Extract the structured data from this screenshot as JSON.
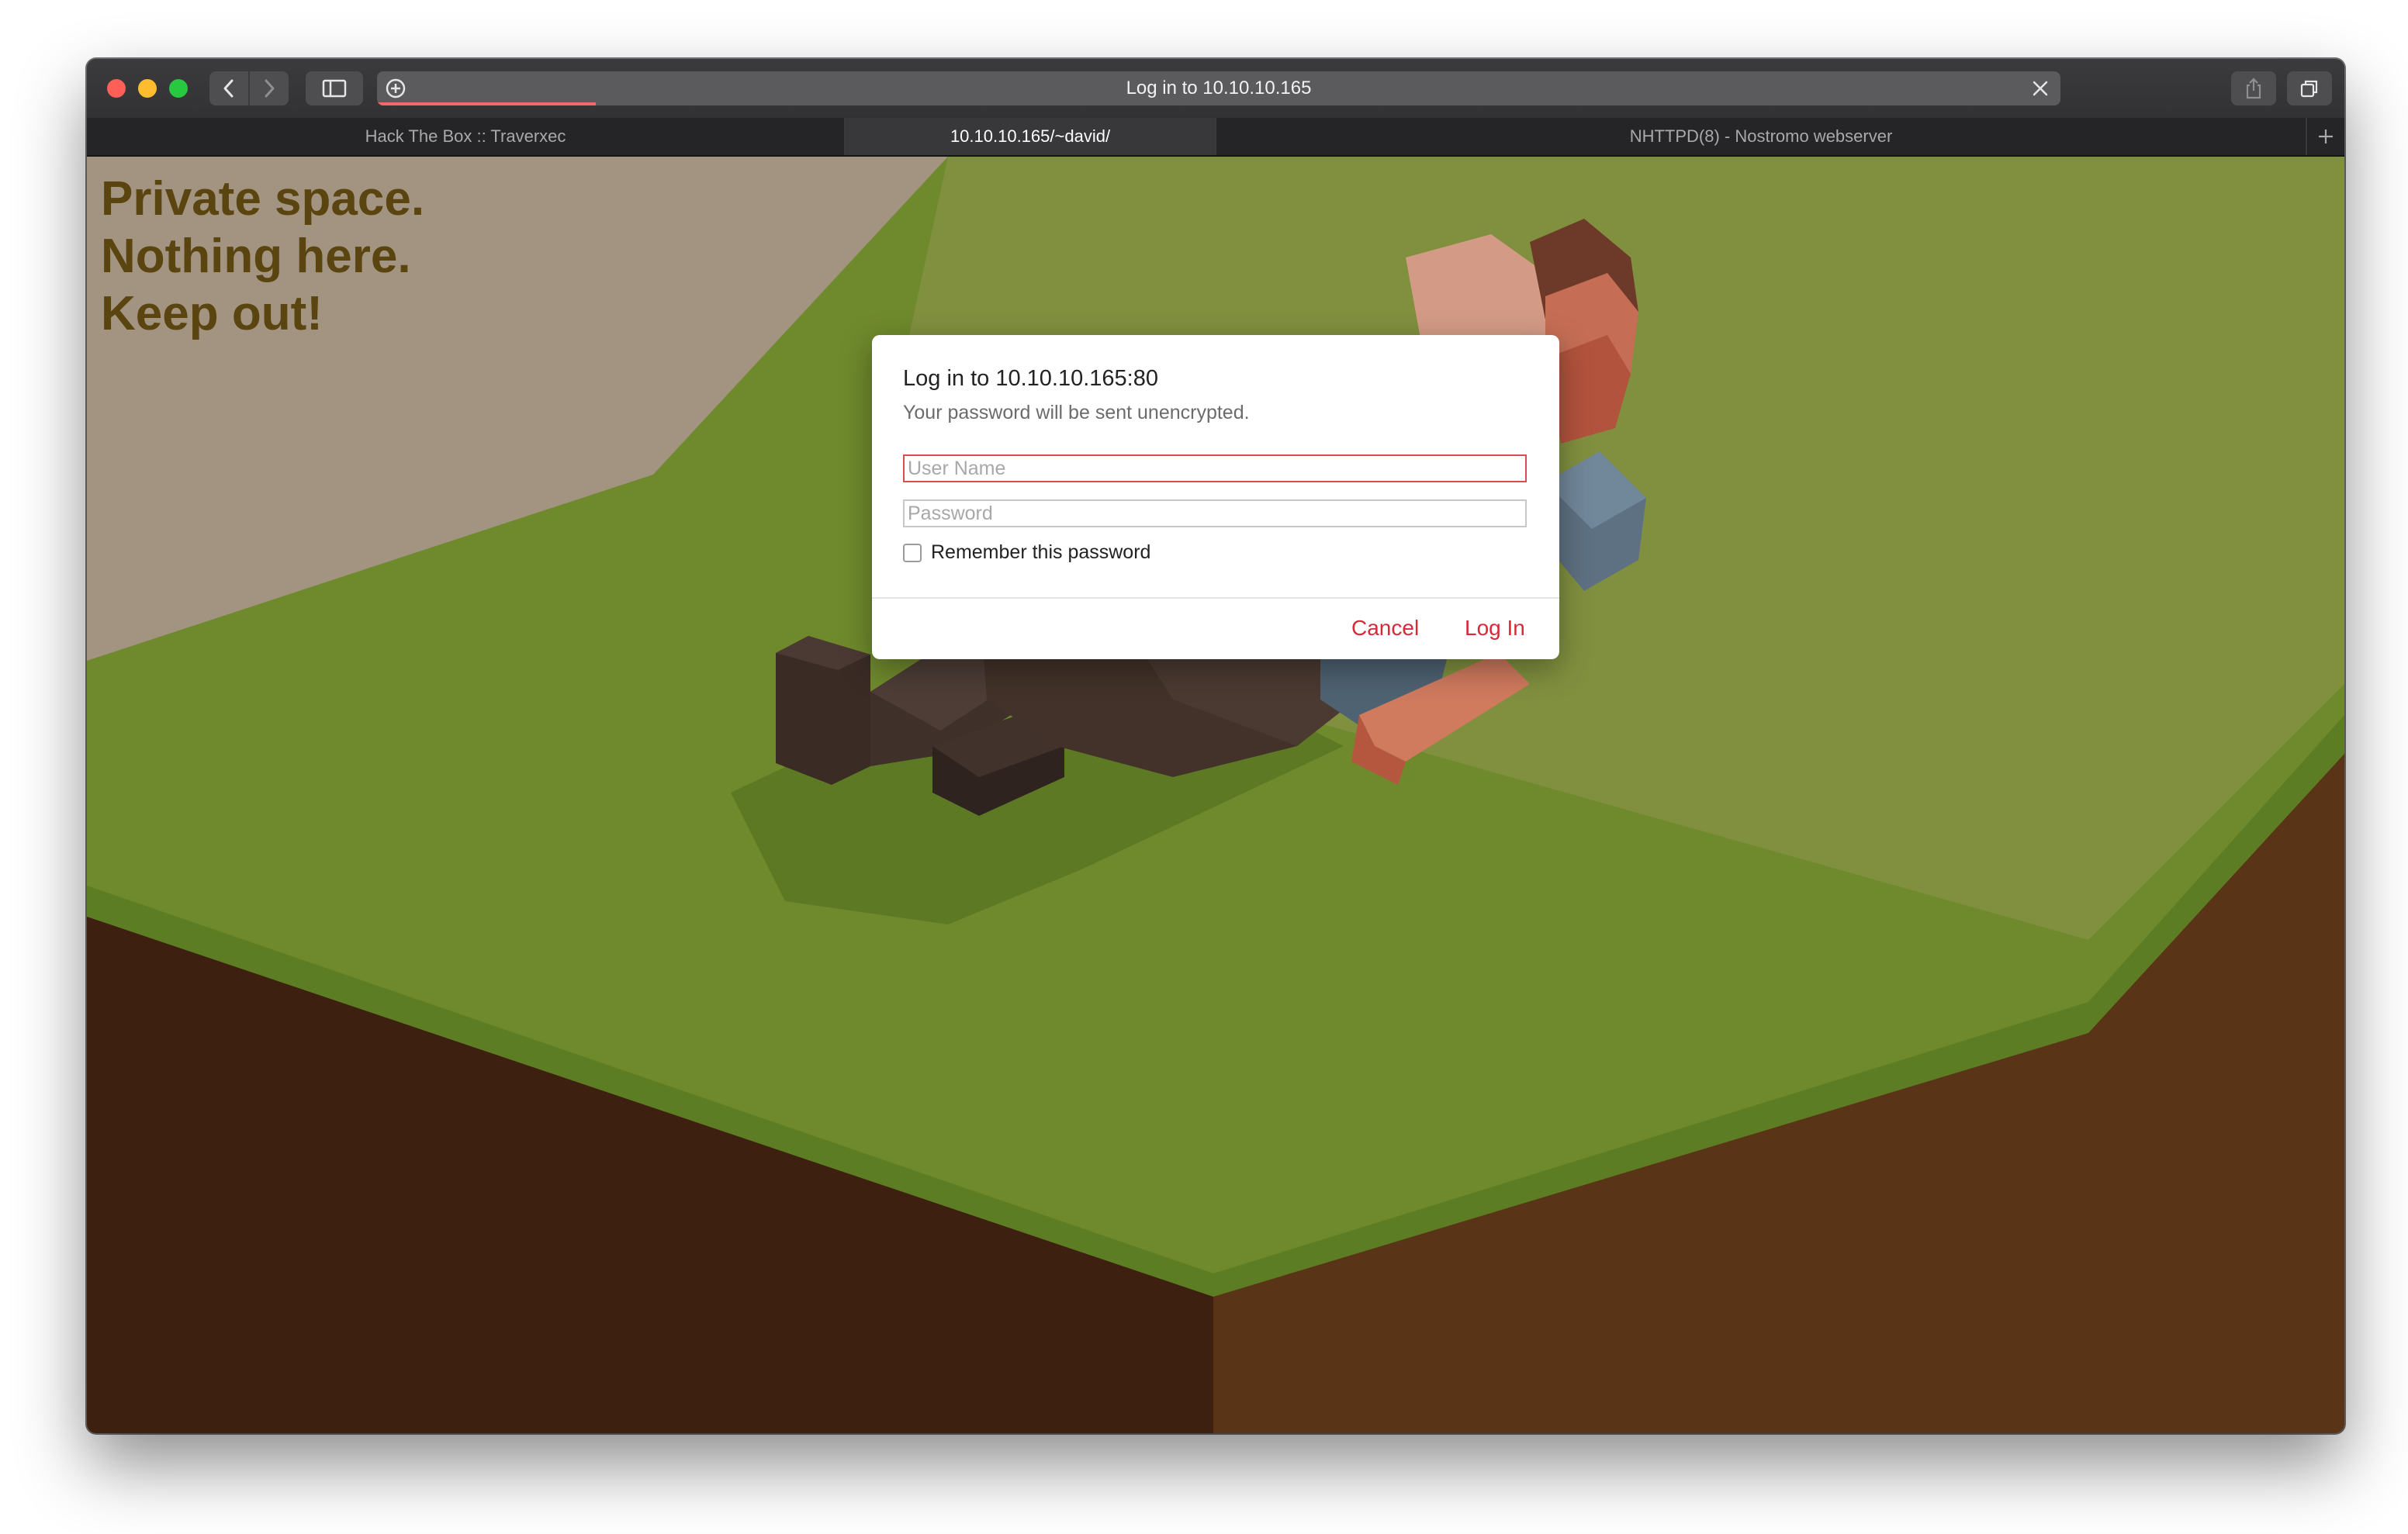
{
  "browser": {
    "address_title": "Log in to 10.10.10.165",
    "tabs": [
      {
        "label": "Hack The Box :: Traverxec"
      },
      {
        "label": "10.10.10.165/~david/"
      },
      {
        "label": "NHTTPD(8) - Nostromo webserver"
      }
    ],
    "loading_progress": 0.13
  },
  "page": {
    "headline": [
      "Private space.",
      "Nothing here.",
      "Keep out!"
    ],
    "headline_color": "#5a4410"
  },
  "dialog": {
    "title": "Log in to 10.10.10.165:80",
    "subtitle": "Your password will be sent unencrypted.",
    "username_placeholder": "User Name",
    "username_value": "",
    "password_placeholder": "Password",
    "password_value": "",
    "remember_label": "Remember this password",
    "remember_checked": false,
    "cancel_label": "Cancel",
    "login_label": "Log In",
    "accent_color": "#d9283a"
  },
  "icons": [
    "back-icon",
    "forward-icon",
    "sidebar-icon",
    "add-bookmark-icon",
    "stop-loading-icon",
    "share-icon",
    "tabs-overview-icon",
    "new-tab-icon"
  ]
}
